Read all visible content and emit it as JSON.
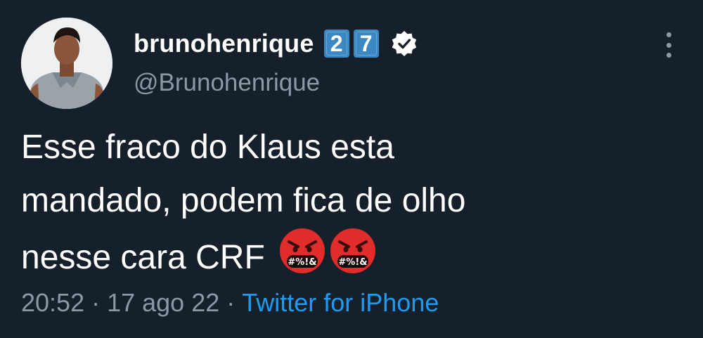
{
  "author": {
    "display_name": "brunohenrique",
    "keycaps": [
      "2",
      "7"
    ],
    "handle": "@Brunohenrique",
    "verified_icon": "verified-badge-icon",
    "avatar_icon": "avatar-photo"
  },
  "tweet": {
    "line1": "Esse fraco do Klaus esta",
    "line2": "mandado, podem fica de olho",
    "line3": "nesse cara CRF",
    "emoji": [
      "face-with-symbols-on-mouth-icon",
      "face-with-symbols-on-mouth-icon"
    ],
    "emoji_text": "#%!&"
  },
  "meta": {
    "time": "20:52",
    "separator": "·",
    "date": "17 ago 22",
    "source": "Twitter for iPhone"
  },
  "menu": {
    "icon": "more-vertical-icon"
  },
  "colors": {
    "background": "#15202b",
    "secondary_text": "#8b98a5",
    "link": "#1d9bf0",
    "keycap": "#3b88c3",
    "emoji": "#e12c2c"
  }
}
